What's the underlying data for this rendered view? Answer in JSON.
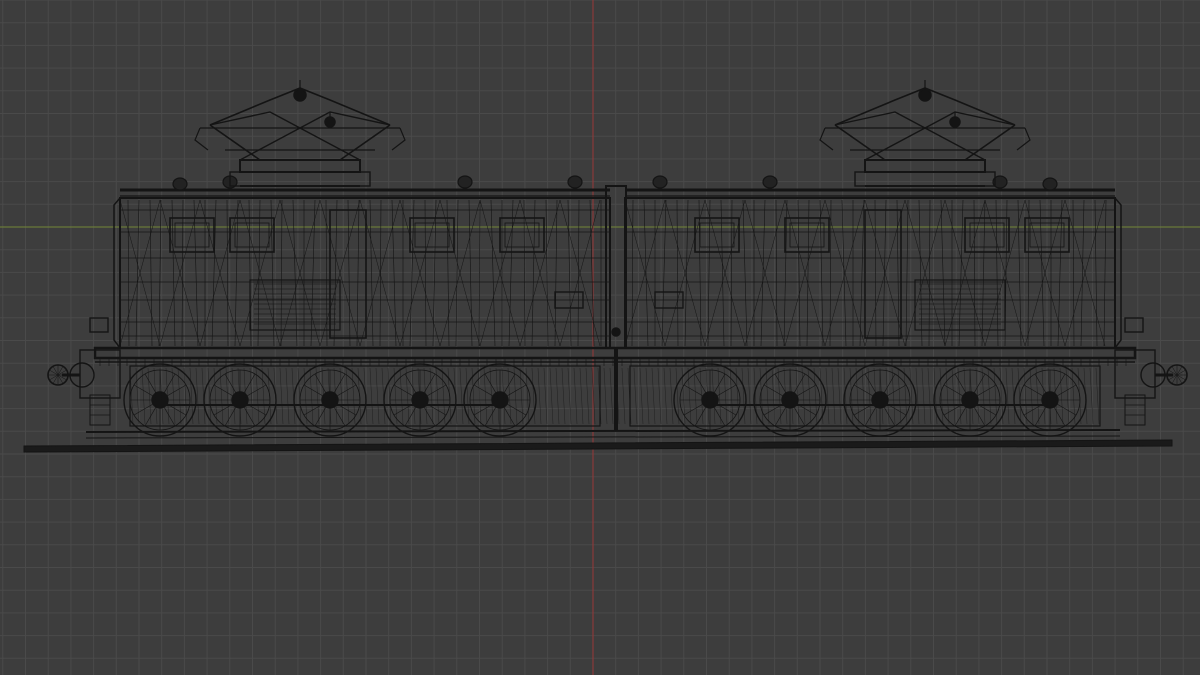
{
  "viewport": {
    "mode": "wireframe",
    "view": "front-orthographic",
    "background_color": "#3d3d3d",
    "grid_color": "#4a4a4a",
    "x_axis_color": "#8a3a3a",
    "y_axis_color": "#6a7a3a"
  },
  "model": {
    "object": "electric-locomotive",
    "wire_color": "#141414",
    "parts": [
      "left-pantograph-icon",
      "right-pantograph-icon",
      "left-cab",
      "right-cab",
      "center-hood",
      "running-gear",
      "left-buffers",
      "right-buffers",
      "track-rail"
    ]
  }
}
